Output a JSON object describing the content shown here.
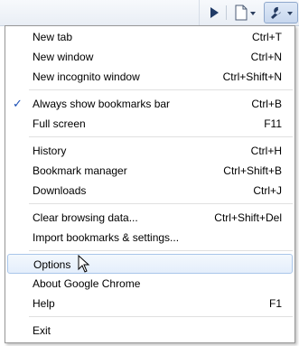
{
  "menu": {
    "items": [
      {
        "label": "New tab",
        "shortcut": "Ctrl+T"
      },
      {
        "label": "New window",
        "shortcut": "Ctrl+N"
      },
      {
        "label": "New incognito window",
        "shortcut": "Ctrl+Shift+N"
      },
      {
        "label": "Always show bookmarks bar",
        "shortcut": "Ctrl+B",
        "checked": true
      },
      {
        "label": "Full screen",
        "shortcut": "F11"
      },
      {
        "label": "History",
        "shortcut": "Ctrl+H"
      },
      {
        "label": "Bookmark manager",
        "shortcut": "Ctrl+Shift+B"
      },
      {
        "label": "Downloads",
        "shortcut": "Ctrl+J"
      },
      {
        "label": "Clear browsing data...",
        "shortcut": "Ctrl+Shift+Del"
      },
      {
        "label": "Import bookmarks & settings...",
        "shortcut": ""
      },
      {
        "label": "Options",
        "shortcut": "",
        "hovered": true
      },
      {
        "label": "About Google Chrome",
        "shortcut": ""
      },
      {
        "label": "Help",
        "shortcut": "F1"
      },
      {
        "label": "Exit",
        "shortcut": ""
      }
    ],
    "check_glyph": "✓"
  },
  "toolbar": {
    "icons": [
      "play-icon",
      "page-menu-icon",
      "wrench-menu-icon"
    ]
  },
  "colors": {
    "hover_border": "#a9c6ea",
    "hover_fill": "#e4eefb",
    "check": "#1a4fb5"
  }
}
